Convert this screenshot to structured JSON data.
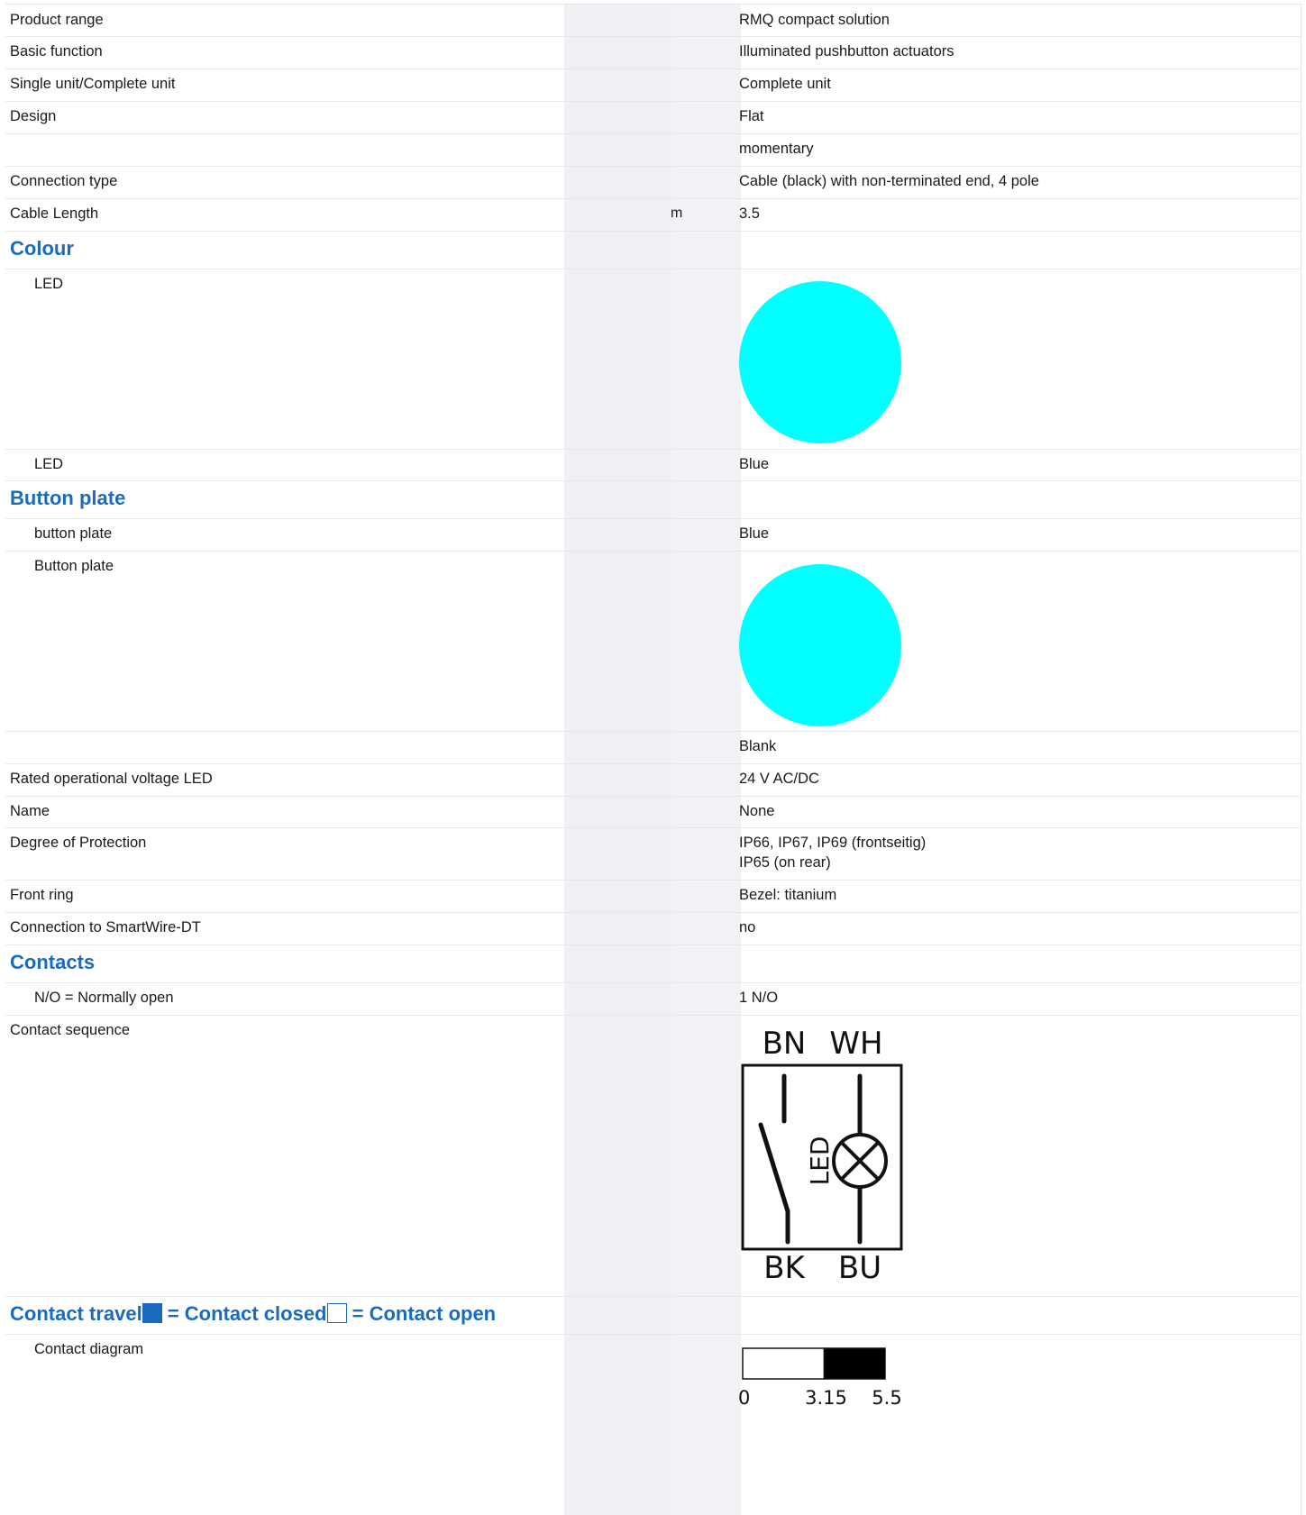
{
  "rows": {
    "product_range": {
      "label": "Product range",
      "value": "RMQ compact solution"
    },
    "basic_function": {
      "label": "Basic function",
      "value": "Illuminated pushbutton actuators"
    },
    "single_complete": {
      "label": "Single unit/Complete unit",
      "value": "Complete unit"
    },
    "design": {
      "label": "Design",
      "value": "Flat"
    },
    "design_extra": {
      "label": "",
      "value": "momentary"
    },
    "connection_type": {
      "label": "Connection type",
      "value": "Cable (black) with non-terminated end, 4 pole"
    },
    "cable_length": {
      "label": "Cable Length",
      "unit": "m",
      "value": "3.5"
    },
    "led_swatch": {
      "label": "LED"
    },
    "led_colour": {
      "label": "LED",
      "value": "Blue"
    },
    "button_plate_colour": {
      "label": "button plate",
      "value": "Blue"
    },
    "button_plate_swatch": {
      "label": "Button plate"
    },
    "button_plate_blank": {
      "label": "",
      "value": "Blank"
    },
    "rated_voltage": {
      "label": "Rated operational voltage LED",
      "value": "24 V AC/DC"
    },
    "name": {
      "label": "Name",
      "value": "None"
    },
    "protection": {
      "label": "Degree of Protection",
      "value": "IP66, IP67, IP69 (frontseitig)\nIP65 (on rear)"
    },
    "front_ring": {
      "label": "Front ring",
      "value": "Bezel: titanium"
    },
    "smartwire": {
      "label": "Connection to SmartWire-DT",
      "value": "no"
    },
    "no_contacts": {
      "label": "N/O = Normally open",
      "value": "1 N/O"
    },
    "contact_sequence": {
      "label": "Contact sequence"
    },
    "contact_diagram": {
      "label": "Contact diagram"
    }
  },
  "headings": {
    "colour": "Colour",
    "button_plate": "Button plate",
    "contacts": "Contacts",
    "travel_a": "Contact travel",
    "travel_b": " = Contact closed",
    "travel_c": " = Contact open"
  },
  "colors": {
    "led_swatch": "#00ffff",
    "button_plate_swatch": "#00ffff",
    "heading": "#1a6bbf"
  },
  "wiring": {
    "top_left": "BN",
    "top_right": "WH",
    "bottom_left": "BK",
    "bottom_right": "BU",
    "lamp_label": "LED"
  },
  "travel": {
    "closed_from": 3.15,
    "max": 5.5,
    "ticks": [
      "0",
      "3.15",
      "5.5"
    ]
  }
}
